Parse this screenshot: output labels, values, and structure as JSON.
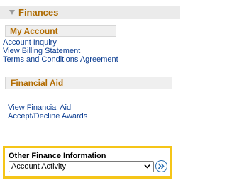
{
  "panel": {
    "title": "Finances"
  },
  "my_account": {
    "title": "My Account",
    "links": [
      "Account Inquiry",
      "View Billing Statement",
      "Terms and Conditions Agreement"
    ]
  },
  "financial_aid": {
    "title": "Financial Aid",
    "links": [
      "View Financial Aid",
      "Accept/Decline Awards"
    ]
  },
  "other_finance": {
    "label": "Other Finance Information",
    "selected": "Account Activity"
  },
  "colors": {
    "header_text": "#ad6a00",
    "link": "#0b3d91",
    "highlight_border": "#f5c518",
    "go_button": "#2a6fb3"
  },
  "icons": {
    "collapse": "triangle-down-icon",
    "dropdown": "chevron-down-icon",
    "go": "double-chevron-right-icon"
  }
}
